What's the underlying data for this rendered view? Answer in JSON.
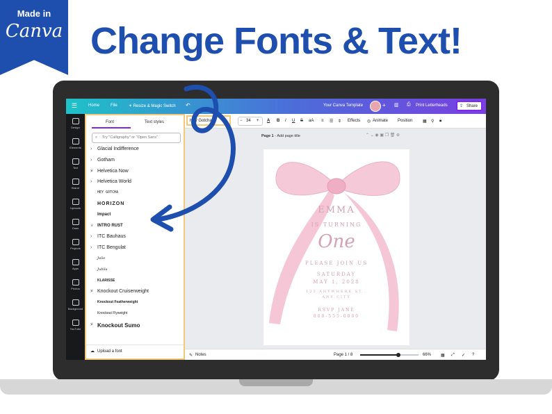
{
  "badge": {
    "made_in": "Made in",
    "brand": "Canva"
  },
  "headline": "Change Fonts & Text!",
  "topbar": {
    "menu_icon": "menu-icon",
    "home": "Home",
    "file": "File",
    "resize": "Resize & Magic Switch",
    "template_name": "Your Canva Template",
    "print_button": "Print Letterheads",
    "share_button": "Share"
  },
  "rail": [
    "Design",
    "Elements",
    "Text",
    "Brand",
    "Uploads",
    "Draw",
    "Projects",
    "Apps",
    "Photos",
    "Background",
    "YouTube"
  ],
  "panel": {
    "tab_font": "Font",
    "tab_styles": "Text styles",
    "search_placeholder": "Try \"Calligraphy\" or \"Open Sans\"",
    "fonts": [
      {
        "name": "Glacial Indifference",
        "expand": true
      },
      {
        "name": "Gotham",
        "expand": true
      },
      {
        "name": "Helvetica Now",
        "expand": true,
        "premium": true
      },
      {
        "name": "Helvetica World",
        "expand": true
      },
      {
        "name": "HEY GOTCHA",
        "expand": false
      },
      {
        "name": "HORIZON",
        "expand": false
      },
      {
        "name": "Impact",
        "expand": false
      },
      {
        "name": "INTRO RUST",
        "expand": false,
        "premium": true
      },
      {
        "name": "ITC Bauhaus",
        "expand": true
      },
      {
        "name": "ITC Bengulat",
        "expand": true
      },
      {
        "name": "Jolie",
        "expand": false
      },
      {
        "name": "Jubila",
        "expand": false
      },
      {
        "name": "KLARISSE",
        "expand": false
      },
      {
        "name": "Knockout Cruiserweight",
        "expand": true,
        "premium": true
      },
      {
        "name": "Knockout Featherweight",
        "expand": false
      },
      {
        "name": "Knockout Flyweight",
        "expand": false
      },
      {
        "name": "Knockout Sumo",
        "expand": true,
        "premium": true
      }
    ],
    "upload_label": "Upload a font"
  },
  "toolbar": {
    "font_value": "Hey Gotcha!",
    "size_value": "34",
    "effects": "Effects",
    "animate": "Animate",
    "position": "Position"
  },
  "page_bar": {
    "page_label": "Page 1",
    "title_placeholder": "Add page title"
  },
  "invitation": {
    "name": "EMMA",
    "turning": "IS TURNING",
    "age": "One",
    "join": "PLEASE JOIN US",
    "day": "SATURDAY",
    "date": "MAY 1, 2028",
    "address": "123 ANYWHERE ST.,",
    "city": "ANY CITY",
    "rsvp": "RSVP JANE",
    "phone": "808-555-0000"
  },
  "footer": {
    "notes": "Notes",
    "page_count": "Page 1 / 8",
    "zoom_percent": 66,
    "zoom_label": "66%"
  },
  "colors": {
    "brand_blue": "#1f4fae",
    "ribbon_pink": "#f4c4d4",
    "text_pink": "#d4a1b3",
    "highlight": "#f3c978",
    "accent_purple": "#7d2ae8"
  }
}
